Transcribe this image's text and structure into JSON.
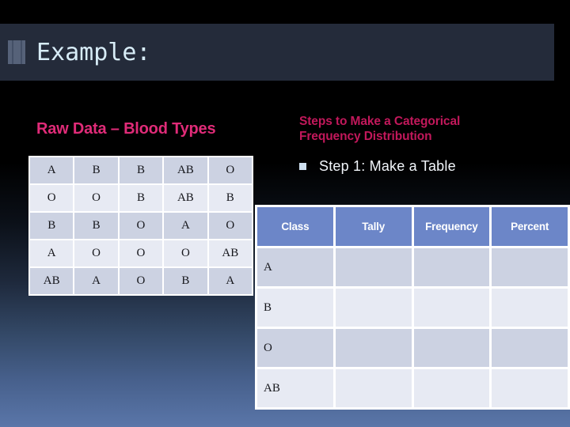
{
  "slide": {
    "title": "Example:",
    "title_icon": "bookmark-icon",
    "background_top_color": "#000000",
    "background_bottom_color": "#5a76a9",
    "title_bar_color": "#242b3a",
    "title_text_color": "#d7ecf7"
  },
  "left": {
    "heading": "Raw Data – Blood Types",
    "heading_color": "#e02b78",
    "raw_table": {
      "rows": [
        [
          "A",
          "B",
          "B",
          "AB",
          "O"
        ],
        [
          "O",
          "O",
          "B",
          "AB",
          "B"
        ],
        [
          "B",
          "B",
          "O",
          "A",
          "O"
        ],
        [
          "A",
          "O",
          "O",
          "O",
          "AB"
        ],
        [
          "AB",
          "A",
          "O",
          "B",
          "A"
        ]
      ]
    }
  },
  "right": {
    "heading_line1": "Steps to Make a Categorical",
    "heading_line2": "Frequency Distribution",
    "heading_color": "#c2185b",
    "step": {
      "bullet_icon": "square-bullet-icon",
      "text": "Step 1: Make a Table"
    },
    "freq_table": {
      "headers": [
        "Class",
        "Tally",
        "Frequency",
        "Percent"
      ],
      "header_bg_color": "#6c86c8",
      "rows": [
        {
          "class": "A",
          "tally": "",
          "frequency": "",
          "percent": ""
        },
        {
          "class": "B",
          "tally": "",
          "frequency": "",
          "percent": ""
        },
        {
          "class": "O",
          "tally": "",
          "frequency": "",
          "percent": ""
        },
        {
          "class": "AB",
          "tally": "",
          "frequency": "",
          "percent": ""
        }
      ]
    }
  }
}
